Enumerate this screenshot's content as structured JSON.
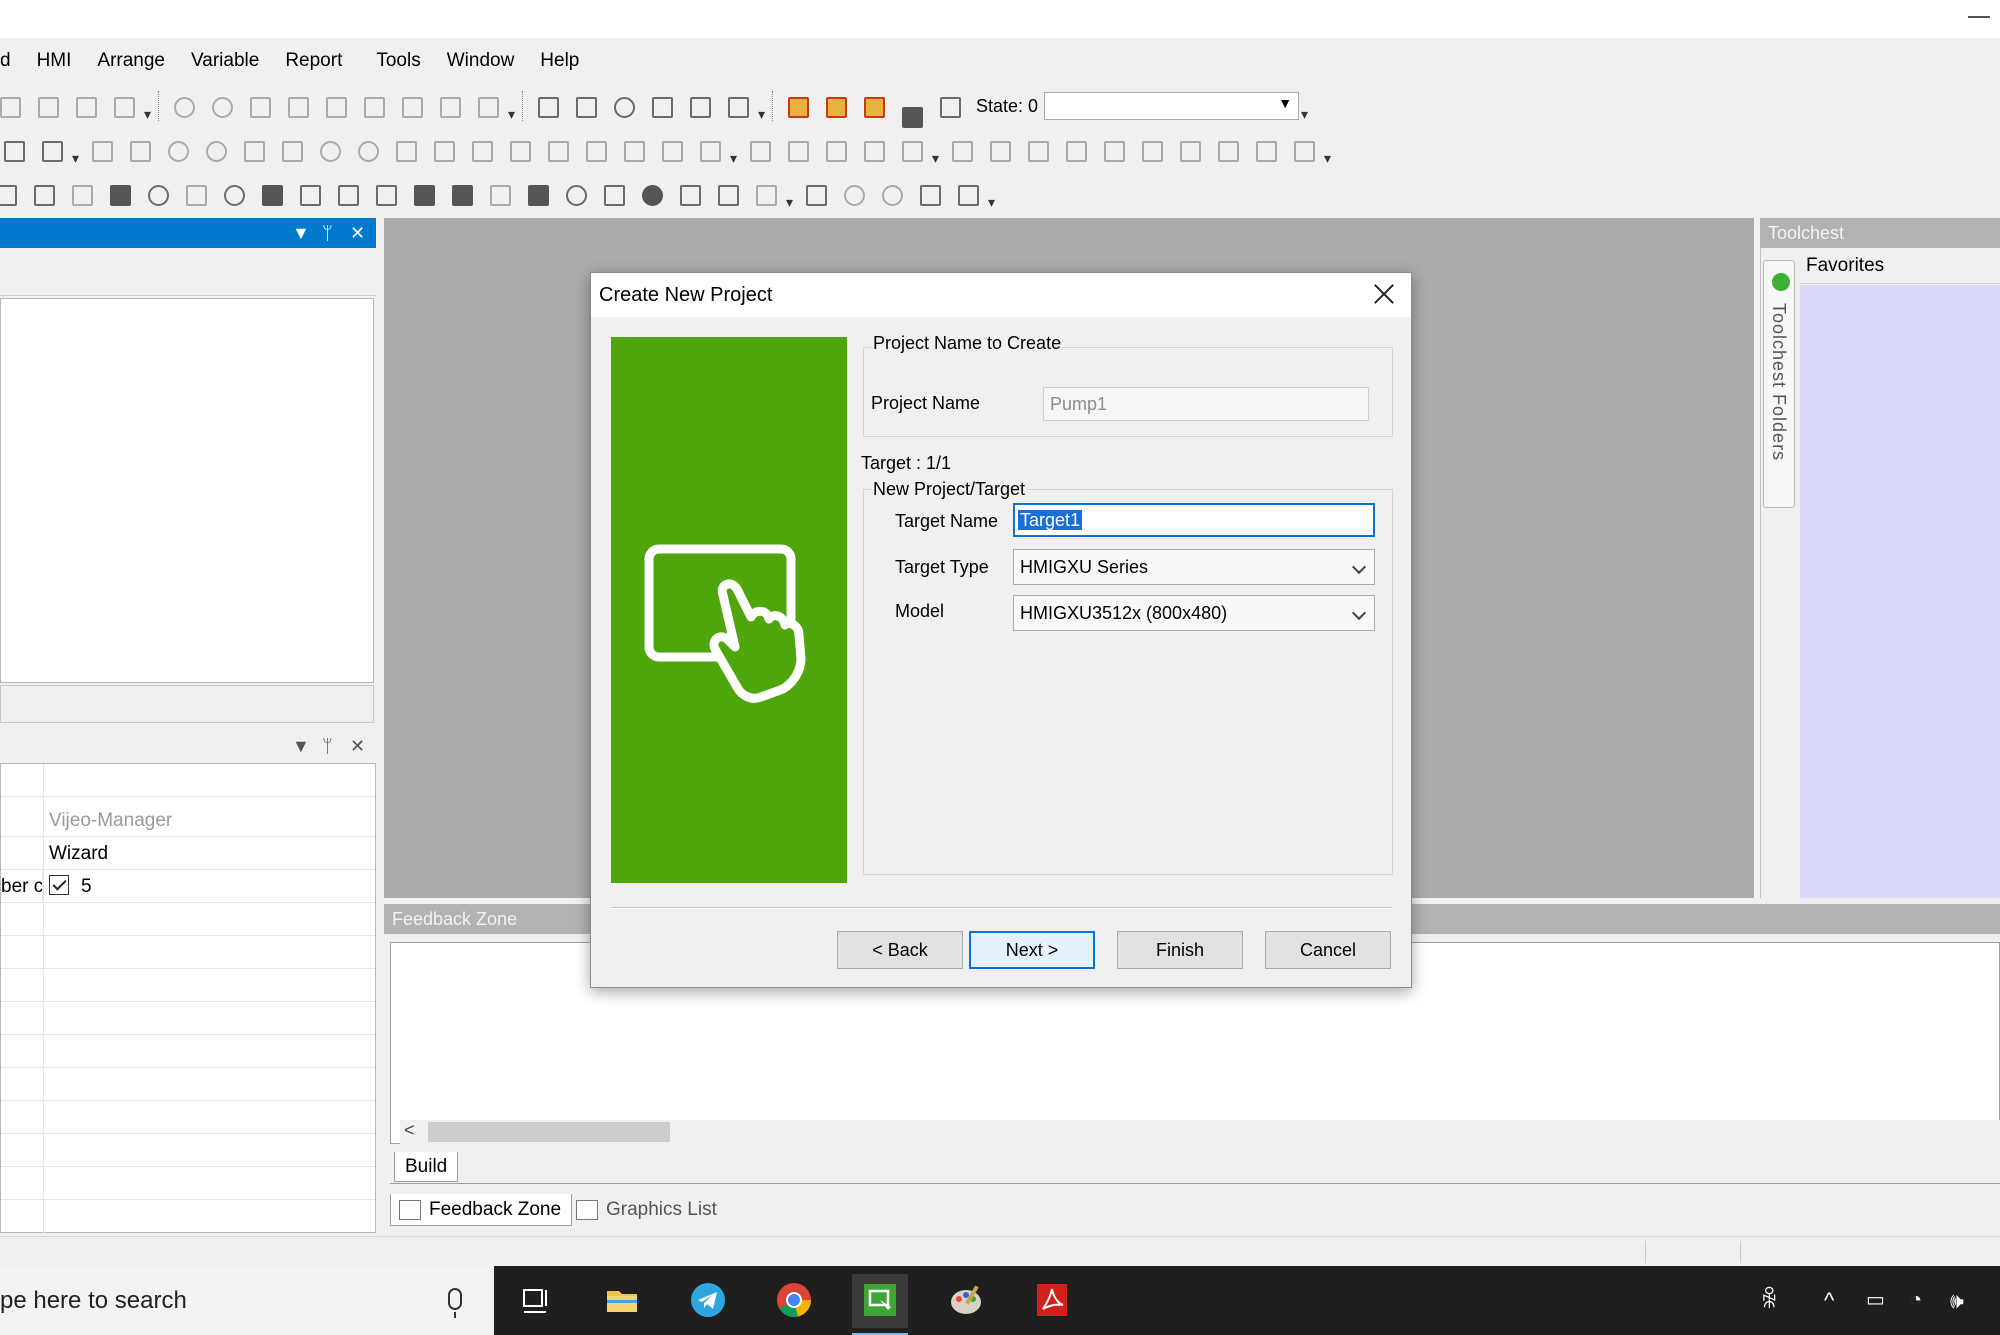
{
  "menu": [
    "d",
    "HMI",
    "Arrange",
    "Variable",
    "Report",
    "Tools",
    "Window",
    "Help"
  ],
  "toolbar": {
    "state_label": "State: 0"
  },
  "left_panel": {
    "properties": {
      "rows": [
        {
          "key": "",
          "value": "Vijeo-Manager",
          "dim": true
        },
        {
          "key": "",
          "value": "Wizard"
        },
        {
          "key": "ber c",
          "value": "5",
          "checkbox": true
        }
      ]
    }
  },
  "toolchest": {
    "title": "Toolchest",
    "folders_label": "Toolchest Folders",
    "favorites_label": "Favorites"
  },
  "feedback": {
    "title": "Feedback Zone",
    "build_tab": "Build",
    "tabs": [
      "Feedback Zone",
      "Graphics List"
    ]
  },
  "taskbar": {
    "search_placeholder": "pe here to search"
  },
  "dialog": {
    "title": "Create New Project",
    "group_project": "Project Name to Create",
    "project_name_label": "Project Name",
    "project_name_value": "Pump1",
    "target_counter": "Target : 1/1",
    "group_target": "New Project/Target",
    "target_name_label": "Target Name",
    "target_name_value": "Target1",
    "target_type_label": "Target Type",
    "target_type_value": "HMIGXU Series",
    "model_label": "Model",
    "model_value": "HMIGXU3512x (800x480)",
    "buttons": {
      "back": "< Back",
      "next": "Next >",
      "finish": "Finish",
      "cancel": "Cancel"
    }
  },
  "colors": {
    "accent": "#007acc",
    "art_green": "#4ea50c",
    "toolchest_fav": "#d9d9f7",
    "focus_blue": "#0a74d9"
  }
}
